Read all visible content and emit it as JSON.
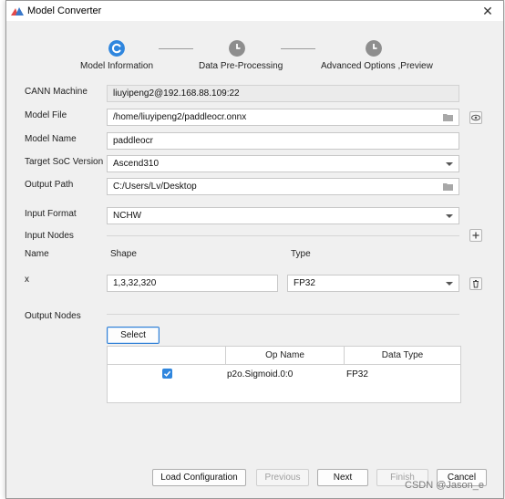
{
  "dialog": {
    "title": "Model Converter",
    "close_glyph": "✕"
  },
  "stepper": {
    "steps": [
      {
        "label": "Model Information",
        "state": "active"
      },
      {
        "label": "Data Pre-Processing",
        "state": "pending"
      },
      {
        "label": "Advanced Options ,Preview",
        "state": "pending"
      }
    ]
  },
  "form": {
    "cann_machine": {
      "label": "CANN Machine",
      "value": "liuyipeng2@192.168.88.109:22"
    },
    "model_file": {
      "label": "Model File",
      "value": "/home/liuyipeng2/paddleocr.onnx"
    },
    "model_name": {
      "label": "Model Name",
      "value": "paddleocr"
    },
    "target_soc": {
      "label": "Target SoC Version",
      "value": "Ascend310"
    },
    "output_path": {
      "label": "Output Path",
      "value": "C:/Users/Lv/Desktop"
    },
    "input_format": {
      "label": "Input Format",
      "value": "NCHW"
    }
  },
  "input_nodes": {
    "label": "Input Nodes",
    "headers": {
      "name": "Name",
      "shape": "Shape",
      "type": "Type"
    },
    "rows": [
      {
        "name": "x",
        "shape": "1,3,32,320",
        "type": "FP32"
      }
    ]
  },
  "output_nodes": {
    "label": "Output Nodes",
    "select_button": "Select",
    "table": {
      "headers": {
        "op_name": "Op Name",
        "data_type": "Data Type"
      },
      "rows": [
        {
          "checked": true,
          "op_name": "p2o.Sigmoid.0:0",
          "data_type": "FP32"
        }
      ]
    }
  },
  "footer": {
    "load_config": "Load Configuration",
    "previous": "Previous",
    "next": "Next",
    "finish": "Finish",
    "cancel": "Cancel"
  },
  "watermark": "CSDN @Jason_e",
  "colors": {
    "accent": "#2f86de",
    "step_pending": "#8e8e8e"
  }
}
